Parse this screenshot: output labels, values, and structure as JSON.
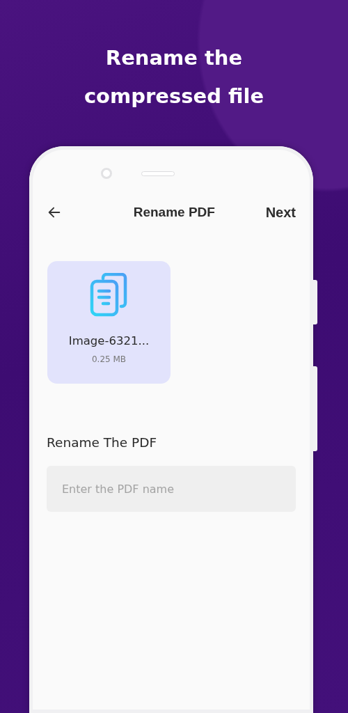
{
  "headline": "Rename the compressed file",
  "header": {
    "title": "Rename PDF",
    "action": "Next"
  },
  "files": [
    {
      "name": "Image-6321...",
      "size": "0.25 MB"
    }
  ],
  "rename": {
    "label": "Rename The PDF",
    "placeholder": "Enter the PDF name"
  }
}
